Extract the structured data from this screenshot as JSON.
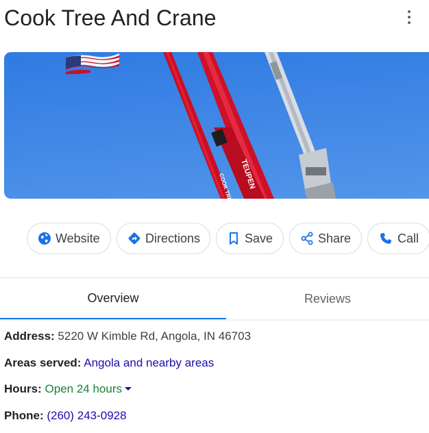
{
  "business": {
    "name": "Cook Tree And Crane"
  },
  "photo": {
    "crane_text_1": "TEUPEN",
    "crane_text_2": "COOK TREE &"
  },
  "actions": {
    "website": "Website",
    "directions": "Directions",
    "save": "Save",
    "share": "Share",
    "call": "Call"
  },
  "tabs": {
    "overview": "Overview",
    "reviews": "Reviews"
  },
  "info": {
    "address_label": "Address:",
    "address_value": "5220 W Kimble Rd, Angola, IN 46703",
    "areas_label": "Areas served:",
    "areas_value": "Angola and nearby areas",
    "hours_label": "Hours:",
    "hours_value": "Open 24 hours",
    "phone_label": "Phone:",
    "phone_value": "(260) 243-0928"
  },
  "colors": {
    "accent": "#1a73e8",
    "link": "#1a0dab",
    "open": "#188038",
    "sky": "#3f86e6",
    "crane_red": "#d6102a"
  }
}
